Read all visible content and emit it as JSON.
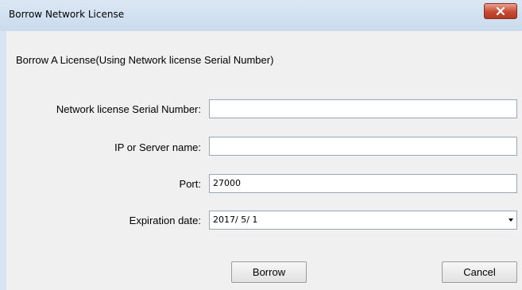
{
  "window": {
    "title": "Borrow Network License",
    "close_icon": "close-icon"
  },
  "heading": "Borrow A License(Using Network license Serial Number)",
  "form": {
    "serial": {
      "label": "Network license Serial Number:",
      "value": ""
    },
    "server": {
      "label": "IP or Server name:",
      "value": ""
    },
    "port": {
      "label": "Port:",
      "value": "27000"
    },
    "expiration": {
      "label": "Expiration date:",
      "value": "2017/ 5/ 1",
      "dropdown_icon": "chevron-down-icon"
    }
  },
  "buttons": {
    "borrow": "Borrow",
    "cancel": "Cancel"
  },
  "colors": {
    "title_bar": "#c9dbee",
    "dialog_face": "#f0f0f0",
    "close_button": "#c74a33"
  }
}
